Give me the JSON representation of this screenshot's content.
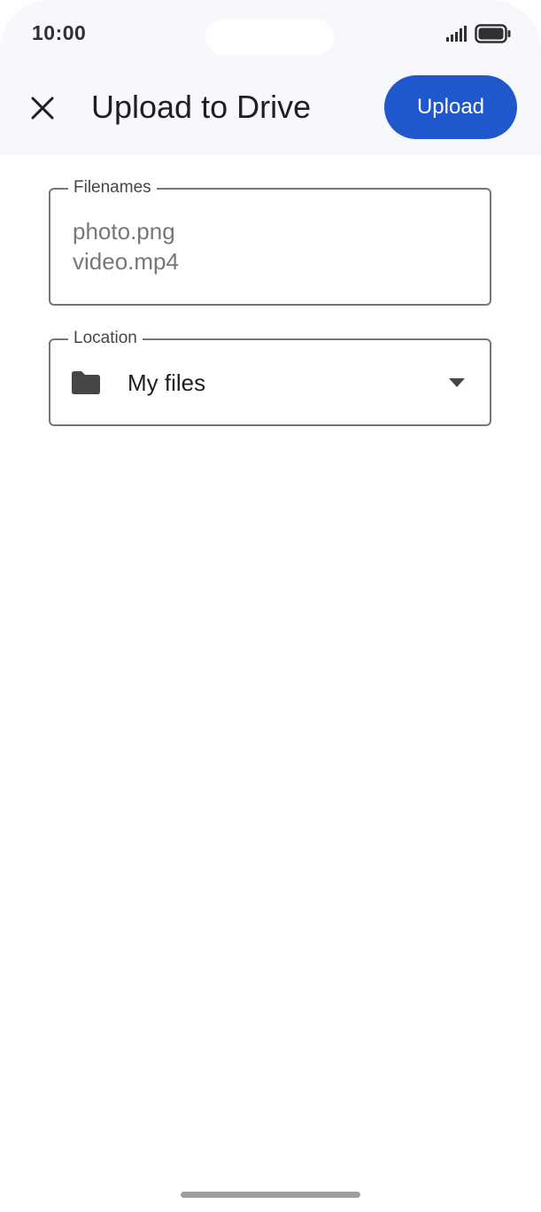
{
  "status_bar": {
    "time": "10:00",
    "signal_icon": "cellular-signal-icon",
    "battery_icon": "battery-full-icon"
  },
  "header": {
    "close_icon": "close-icon",
    "title": "Upload to Drive",
    "upload_label": "Upload",
    "accent_color": "#1f57cc"
  },
  "form": {
    "filenames": {
      "label": "Filenames",
      "value_lines": [
        "photo.png",
        "video.mp4"
      ]
    },
    "location": {
      "label": "Location",
      "icon": "folder-icon",
      "value": "My files",
      "dropdown_icon": "dropdown-arrow-icon"
    }
  }
}
